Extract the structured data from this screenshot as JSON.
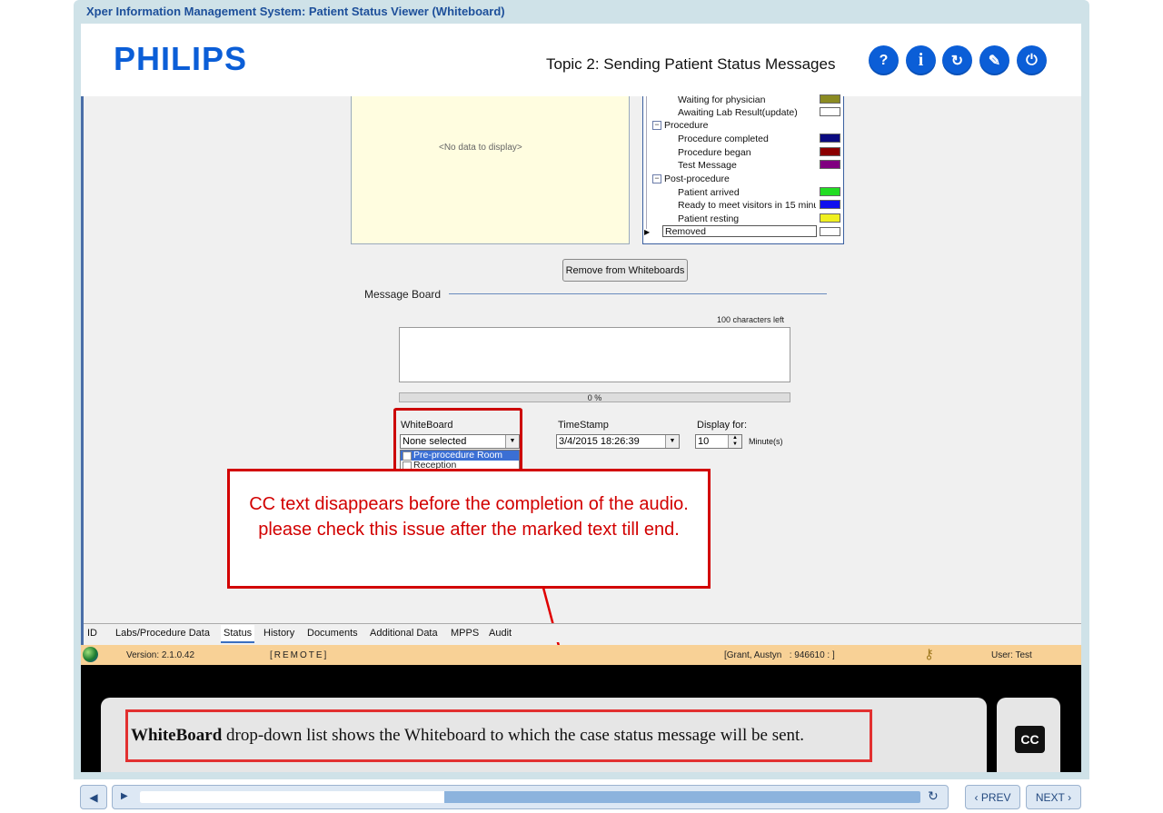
{
  "window": {
    "title": "Xper Information Management System: Patient Status Viewer (Whiteboard)"
  },
  "header": {
    "logo": "PHILIPS",
    "topic": "Topic 2: Sending Patient Status Messages",
    "buttons": [
      {
        "name": "help",
        "glyph": "?"
      },
      {
        "name": "info",
        "glyph": "i"
      },
      {
        "name": "replay",
        "glyph": "↻"
      },
      {
        "name": "glossary",
        "glyph": "✎"
      },
      {
        "name": "exit",
        "glyph": "⏻"
      }
    ]
  },
  "status_panel": {
    "no_data": "<No data to display>"
  },
  "legend": {
    "items": [
      {
        "type": "item",
        "label": "Waiting for physician",
        "color": "#8b8b22"
      },
      {
        "type": "item",
        "label": "Awaiting Lab Result(update)",
        "color": "#ffffff"
      },
      {
        "type": "group",
        "label": "Procedure"
      },
      {
        "type": "item",
        "label": "Procedure completed",
        "color": "#0b0b80"
      },
      {
        "type": "item",
        "label": "Procedure began",
        "color": "#8b0000"
      },
      {
        "type": "item",
        "label": "Test Message",
        "color": "#800080"
      },
      {
        "type": "group",
        "label": "Post-procedure"
      },
      {
        "type": "item",
        "label": "Patient arrived",
        "color": "#22dd22"
      },
      {
        "type": "item",
        "label": "Ready to meet visitors in 15 minu",
        "color": "#1010ee"
      },
      {
        "type": "item",
        "label": "Patient resting",
        "color": "#f0f020"
      },
      {
        "type": "item",
        "label": "Removed",
        "color": "#ffffff"
      }
    ]
  },
  "remove_button": "Remove from Whiteboards",
  "message_board": {
    "title": "Message Board",
    "chars_left": "100 characters left",
    "progress": "0 %",
    "whiteboard_label": "WhiteBoard",
    "whiteboard_value": "None selected",
    "whiteboard_options": [
      "Pre-procedure Room",
      "Reception"
    ],
    "timestamp_label": "TimeStamp",
    "timestamp_value": "3/4/2015 18:26:39",
    "display_label": "Display for:",
    "display_value": "10",
    "display_unit": "Minute(s)"
  },
  "callout": {
    "text": "CC text disappears before the completion of the audio. please check this issue after the marked text till end."
  },
  "tabs": [
    "ID",
    "Labs/Procedure Data",
    "Status",
    "History",
    "Documents",
    "Additional Data",
    "MPPS",
    "Audit"
  ],
  "statusbar": {
    "version": "Version: 2.1.0.42",
    "mode": "[REMOTE]",
    "patient": "[Grant, Austyn   : 946610 : ]",
    "user": "User: Test"
  },
  "caption": {
    "bold": "WhiteBoard",
    "rest": " drop-down list shows the Whiteboard to which the case status message will be sent.",
    "cc_button": "CC"
  },
  "player": {
    "progress": 0.39,
    "prev": "PREV",
    "next": "NEXT"
  }
}
